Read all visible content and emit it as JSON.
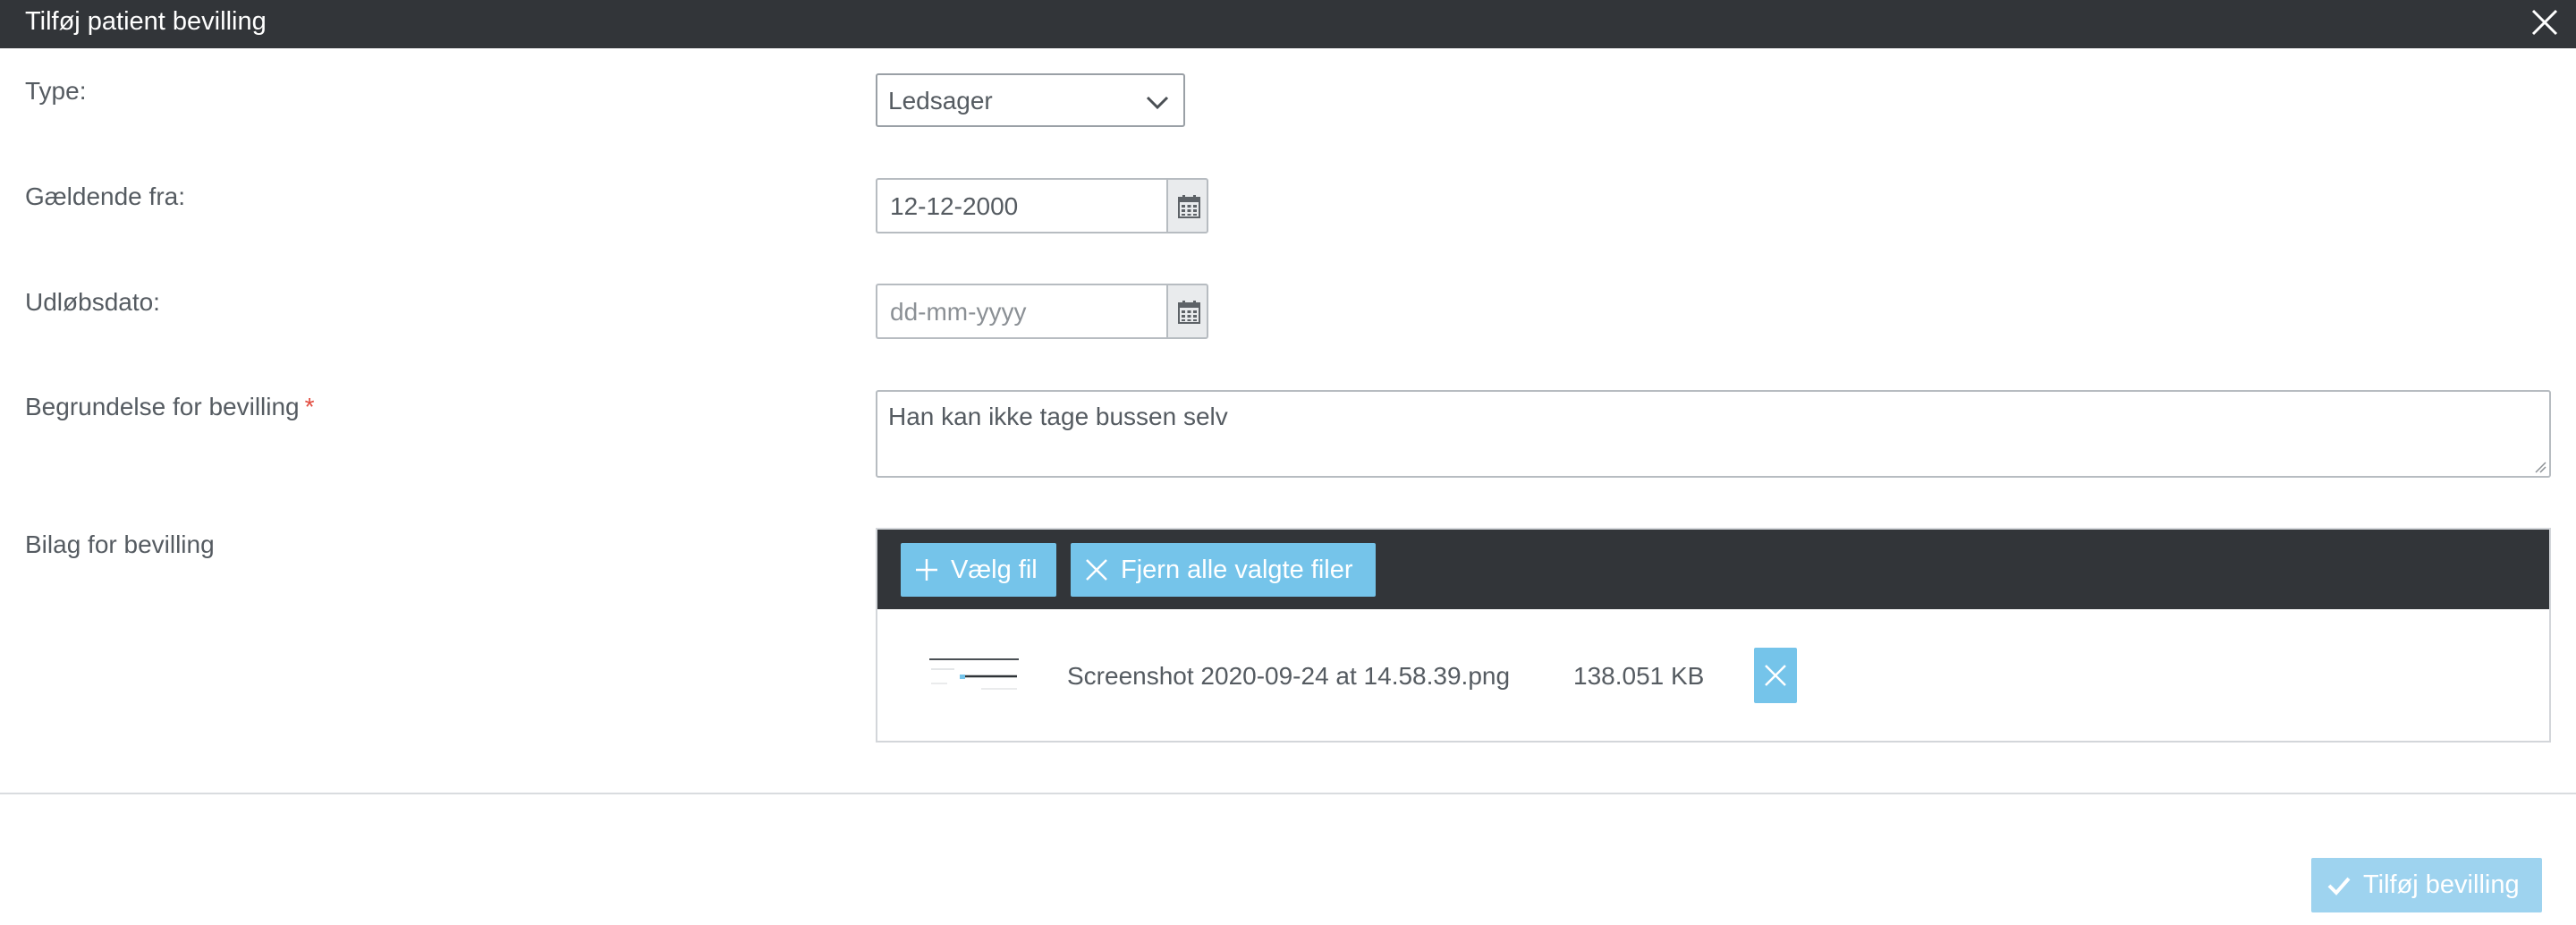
{
  "dialog": {
    "title": "Tilføj patient bevilling",
    "close_icon": "close-icon"
  },
  "form": {
    "type": {
      "label": "Type:",
      "value": "Ledsager"
    },
    "valid_from": {
      "label": "Gældende fra:",
      "value": "12-12-2000"
    },
    "expiry": {
      "label": "Udløbsdato:",
      "placeholder": "dd-mm-yyyy"
    },
    "reason": {
      "label": "Begrundelse for bevilling",
      "required_mark": "*",
      "value": "Han kan ikke tage bussen selv"
    },
    "attachments": {
      "label": "Bilag for bevilling",
      "choose_button": "Vælg fil",
      "remove_all_button": "Fjern alle valgte filer",
      "files": [
        {
          "name": "Screenshot 2020-09-24 at 14.58.39.png",
          "size": "138.051 KB"
        }
      ]
    }
  },
  "footer": {
    "submit_button": "Tilføj bevilling"
  },
  "colors": {
    "titlebar": "#323539",
    "accent_button": "#75c4ea",
    "submit_button_disabled": "#9ed3ef",
    "required_mark": "#e24c3f"
  }
}
